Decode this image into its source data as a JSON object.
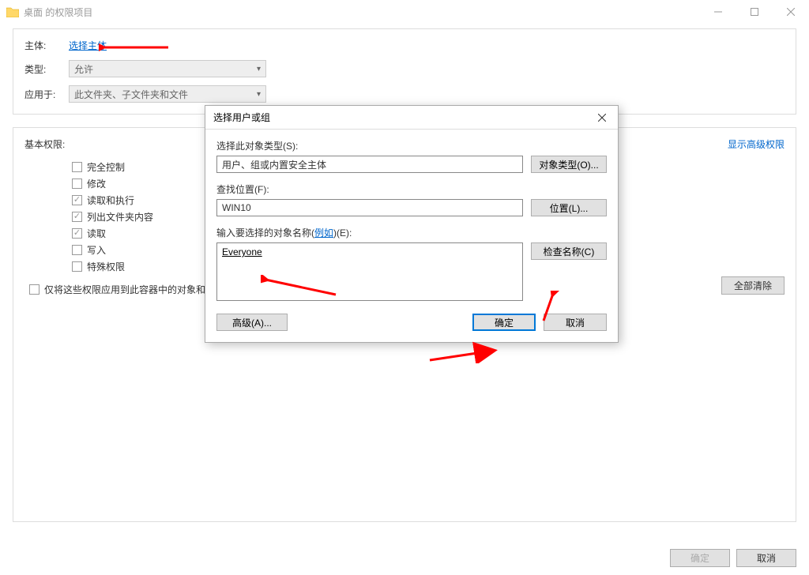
{
  "window": {
    "title": "桌面 的权限项目"
  },
  "fields": {
    "principal_label": "主体:",
    "principal_link": "选择主体",
    "type_label": "类型:",
    "type_value": "允许",
    "applies_label": "应用于:",
    "applies_value": "此文件夹、子文件夹和文件"
  },
  "perm": {
    "title": "基本权限:",
    "adv_link": "显示高级权限",
    "items": [
      {
        "label": "完全控制",
        "checked": false
      },
      {
        "label": "修改",
        "checked": false
      },
      {
        "label": "读取和执行",
        "checked": true
      },
      {
        "label": "列出文件夹内容",
        "checked": true
      },
      {
        "label": "读取",
        "checked": true
      },
      {
        "label": "写入",
        "checked": false
      },
      {
        "label": "特殊权限",
        "checked": false
      }
    ],
    "apply_only": "仅将这些权限应用到此容器中的对象和",
    "clear_all": "全部清除"
  },
  "footer": {
    "ok": "确定",
    "cancel": "取消"
  },
  "modal": {
    "title": "选择用户或组",
    "obj_type_label": "选择此对象类型(S):",
    "obj_type_value": "用户、组或内置安全主体",
    "obj_type_btn": "对象类型(O)...",
    "location_label": "查找位置(F):",
    "location_value": "WIN10",
    "location_btn": "位置(L)...",
    "names_label_prefix": "输入要选择的对象名称(",
    "names_label_link": "例如",
    "names_label_suffix": ")(E):",
    "names_value": "Everyone",
    "check_btn": "检查名称(C)",
    "advanced_btn": "高级(A)...",
    "ok": "确定",
    "cancel": "取消"
  }
}
